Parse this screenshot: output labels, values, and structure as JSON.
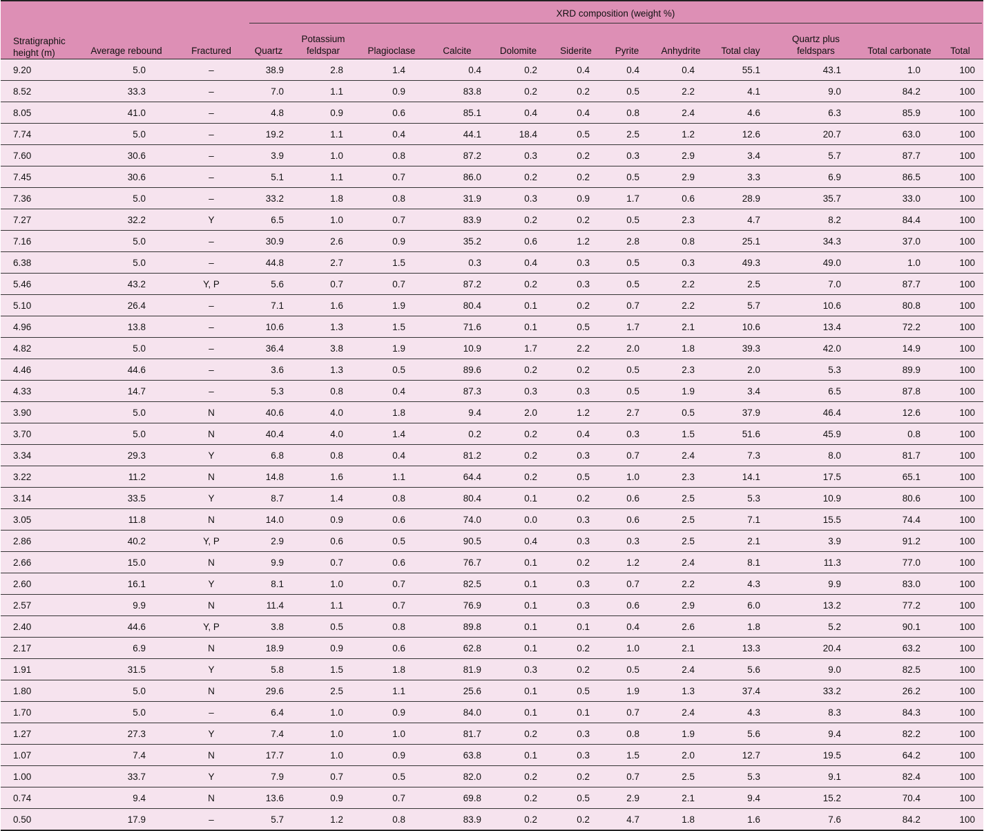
{
  "table": {
    "group_header": "XRD composition (weight %)",
    "columns": [
      "Stratigraphic height (m)",
      "Average rebound",
      "Fractured",
      "Quartz",
      "Potassium feldspar",
      "Plagioclase",
      "Calcite",
      "Dolomite",
      "Siderite",
      "Pyrite",
      "Anhydrite",
      "Total clay",
      "Quartz plus feldspars",
      "Total carbonate",
      "Total"
    ],
    "rows": [
      [
        "9.20",
        "5.0",
        "–",
        "38.9",
        "2.8",
        "1.4",
        "0.4",
        "0.2",
        "0.4",
        "0.4",
        "0.4",
        "55.1",
        "43.1",
        "1.0",
        "100"
      ],
      [
        "8.52",
        "33.3",
        "–",
        "7.0",
        "1.1",
        "0.9",
        "83.8",
        "0.2",
        "0.2",
        "0.5",
        "2.2",
        "4.1",
        "9.0",
        "84.2",
        "100"
      ],
      [
        "8.05",
        "41.0",
        "–",
        "4.8",
        "0.9",
        "0.6",
        "85.1",
        "0.4",
        "0.4",
        "0.8",
        "2.4",
        "4.6",
        "6.3",
        "85.9",
        "100"
      ],
      [
        "7.74",
        "5.0",
        "–",
        "19.2",
        "1.1",
        "0.4",
        "44.1",
        "18.4",
        "0.5",
        "2.5",
        "1.2",
        "12.6",
        "20.7",
        "63.0",
        "100"
      ],
      [
        "7.60",
        "30.6",
        "–",
        "3.9",
        "1.0",
        "0.8",
        "87.2",
        "0.3",
        "0.2",
        "0.3",
        "2.9",
        "3.4",
        "5.7",
        "87.7",
        "100"
      ],
      [
        "7.45",
        "30.6",
        "–",
        "5.1",
        "1.1",
        "0.7",
        "86.0",
        "0.2",
        "0.2",
        "0.5",
        "2.9",
        "3.3",
        "6.9",
        "86.5",
        "100"
      ],
      [
        "7.36",
        "5.0",
        "–",
        "33.2",
        "1.8",
        "0.8",
        "31.9",
        "0.3",
        "0.9",
        "1.7",
        "0.6",
        "28.9",
        "35.7",
        "33.0",
        "100"
      ],
      [
        "7.27",
        "32.2",
        "Y",
        "6.5",
        "1.0",
        "0.7",
        "83.9",
        "0.2",
        "0.2",
        "0.5",
        "2.3",
        "4.7",
        "8.2",
        "84.4",
        "100"
      ],
      [
        "7.16",
        "5.0",
        "–",
        "30.9",
        "2.6",
        "0.9",
        "35.2",
        "0.6",
        "1.2",
        "2.8",
        "0.8",
        "25.1",
        "34.3",
        "37.0",
        "100"
      ],
      [
        "6.38",
        "5.0",
        "–",
        "44.8",
        "2.7",
        "1.5",
        "0.3",
        "0.4",
        "0.3",
        "0.5",
        "0.3",
        "49.3",
        "49.0",
        "1.0",
        "100"
      ],
      [
        "5.46",
        "43.2",
        "Y, P",
        "5.6",
        "0.7",
        "0.7",
        "87.2",
        "0.2",
        "0.3",
        "0.5",
        "2.2",
        "2.5",
        "7.0",
        "87.7",
        "100"
      ],
      [
        "5.10",
        "26.4",
        "–",
        "7.1",
        "1.6",
        "1.9",
        "80.4",
        "0.1",
        "0.2",
        "0.7",
        "2.2",
        "5.7",
        "10.6",
        "80.8",
        "100"
      ],
      [
        "4.96",
        "13.8",
        "–",
        "10.6",
        "1.3",
        "1.5",
        "71.6",
        "0.1",
        "0.5",
        "1.7",
        "2.1",
        "10.6",
        "13.4",
        "72.2",
        "100"
      ],
      [
        "4.82",
        "5.0",
        "–",
        "36.4",
        "3.8",
        "1.9",
        "10.9",
        "1.7",
        "2.2",
        "2.0",
        "1.8",
        "39.3",
        "42.0",
        "14.9",
        "100"
      ],
      [
        "4.46",
        "44.6",
        "–",
        "3.6",
        "1.3",
        "0.5",
        "89.6",
        "0.2",
        "0.2",
        "0.5",
        "2.3",
        "2.0",
        "5.3",
        "89.9",
        "100"
      ],
      [
        "4.33",
        "14.7",
        "–",
        "5.3",
        "0.8",
        "0.4",
        "87.3",
        "0.3",
        "0.3",
        "0.5",
        "1.9",
        "3.4",
        "6.5",
        "87.8",
        "100"
      ],
      [
        "3.90",
        "5.0",
        "N",
        "40.6",
        "4.0",
        "1.8",
        "9.4",
        "2.0",
        "1.2",
        "2.7",
        "0.5",
        "37.9",
        "46.4",
        "12.6",
        "100"
      ],
      [
        "3.70",
        "5.0",
        "N",
        "40.4",
        "4.0",
        "1.4",
        "0.2",
        "0.2",
        "0.4",
        "0.3",
        "1.5",
        "51.6",
        "45.9",
        "0.8",
        "100"
      ],
      [
        "3.34",
        "29.3",
        "Y",
        "6.8",
        "0.8",
        "0.4",
        "81.2",
        "0.2",
        "0.3",
        "0.7",
        "2.4",
        "7.3",
        "8.0",
        "81.7",
        "100"
      ],
      [
        "3.22",
        "11.2",
        "N",
        "14.8",
        "1.6",
        "1.1",
        "64.4",
        "0.2",
        "0.5",
        "1.0",
        "2.3",
        "14.1",
        "17.5",
        "65.1",
        "100"
      ],
      [
        "3.14",
        "33.5",
        "Y",
        "8.7",
        "1.4",
        "0.8",
        "80.4",
        "0.1",
        "0.2",
        "0.6",
        "2.5",
        "5.3",
        "10.9",
        "80.6",
        "100"
      ],
      [
        "3.05",
        "11.8",
        "N",
        "14.0",
        "0.9",
        "0.6",
        "74.0",
        "0.0",
        "0.3",
        "0.6",
        "2.5",
        "7.1",
        "15.5",
        "74.4",
        "100"
      ],
      [
        "2.86",
        "40.2",
        "Y, P",
        "2.9",
        "0.6",
        "0.5",
        "90.5",
        "0.4",
        "0.3",
        "0.3",
        "2.5",
        "2.1",
        "3.9",
        "91.2",
        "100"
      ],
      [
        "2.66",
        "15.0",
        "N",
        "9.9",
        "0.7",
        "0.6",
        "76.7",
        "0.1",
        "0.2",
        "1.2",
        "2.4",
        "8.1",
        "11.3",
        "77.0",
        "100"
      ],
      [
        "2.60",
        "16.1",
        "Y",
        "8.1",
        "1.0",
        "0.7",
        "82.5",
        "0.1",
        "0.3",
        "0.7",
        "2.2",
        "4.3",
        "9.9",
        "83.0",
        "100"
      ],
      [
        "2.57",
        "9.9",
        "N",
        "11.4",
        "1.1",
        "0.7",
        "76.9",
        "0.1",
        "0.3",
        "0.6",
        "2.9",
        "6.0",
        "13.2",
        "77.2",
        "100"
      ],
      [
        "2.40",
        "44.6",
        "Y, P",
        "3.8",
        "0.5",
        "0.8",
        "89.8",
        "0.1",
        "0.1",
        "0.4",
        "2.6",
        "1.8",
        "5.2",
        "90.1",
        "100"
      ],
      [
        "2.17",
        "6.9",
        "N",
        "18.9",
        "0.9",
        "0.6",
        "62.8",
        "0.1",
        "0.2",
        "1.0",
        "2.1",
        "13.3",
        "20.4",
        "63.2",
        "100"
      ],
      [
        "1.91",
        "31.5",
        "Y",
        "5.8",
        "1.5",
        "1.8",
        "81.9",
        "0.3",
        "0.2",
        "0.5",
        "2.4",
        "5.6",
        "9.0",
        "82.5",
        "100"
      ],
      [
        "1.80",
        "5.0",
        "N",
        "29.6",
        "2.5",
        "1.1",
        "25.6",
        "0.1",
        "0.5",
        "1.9",
        "1.3",
        "37.4",
        "33.2",
        "26.2",
        "100"
      ],
      [
        "1.70",
        "5.0",
        "–",
        "6.4",
        "1.0",
        "0.9",
        "84.0",
        "0.1",
        "0.1",
        "0.7",
        "2.4",
        "4.3",
        "8.3",
        "84.3",
        "100"
      ],
      [
        "1.27",
        "27.3",
        "Y",
        "7.4",
        "1.0",
        "1.0",
        "81.7",
        "0.2",
        "0.3",
        "0.8",
        "1.9",
        "5.6",
        "9.4",
        "82.2",
        "100"
      ],
      [
        "1.07",
        "7.4",
        "N",
        "17.7",
        "1.0",
        "0.9",
        "63.8",
        "0.1",
        "0.3",
        "1.5",
        "2.0",
        "12.7",
        "19.5",
        "64.2",
        "100"
      ],
      [
        "1.00",
        "33.7",
        "Y",
        "7.9",
        "0.7",
        "0.5",
        "82.0",
        "0.2",
        "0.2",
        "0.7",
        "2.5",
        "5.3",
        "9.1",
        "82.4",
        "100"
      ],
      [
        "0.74",
        "9.4",
        "N",
        "13.6",
        "0.9",
        "0.7",
        "69.8",
        "0.2",
        "0.5",
        "2.9",
        "2.1",
        "9.4",
        "15.2",
        "70.4",
        "100"
      ],
      [
        "0.50",
        "17.9",
        "–",
        "5.7",
        "1.2",
        "0.8",
        "83.9",
        "0.2",
        "0.2",
        "4.7",
        "1.8",
        "1.6",
        "7.6",
        "84.2",
        "100"
      ]
    ]
  },
  "colors": {
    "header_bg": "#dd8fb5",
    "row_bg": "#f6e3ee",
    "rule": "#333333"
  }
}
